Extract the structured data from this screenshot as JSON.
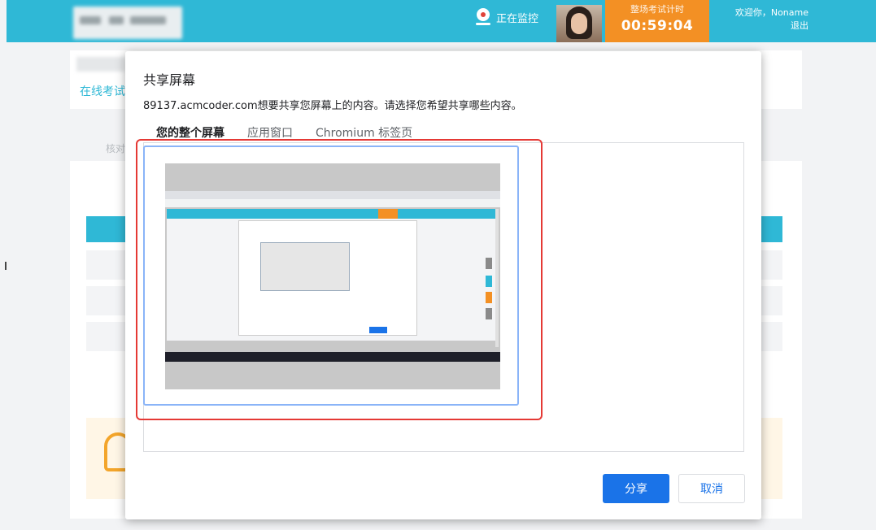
{
  "header": {
    "monitor_status": "正在监控",
    "timer_label": "整场考试计时",
    "timer_value": "00:59:04",
    "welcome_text": "欢迎你，Noname",
    "logout_label": "退出"
  },
  "background": {
    "tab_label": "在线考试",
    "section_label": "核对"
  },
  "dialog": {
    "title": "共享屏幕",
    "description": "89137.acmcoder.com想要共享您屏幕上的内容。请选择您希望共享哪些内容。",
    "tabs": [
      {
        "label": "您的整个屏幕",
        "active": true
      },
      {
        "label": "应用窗口",
        "active": false
      },
      {
        "label": "Chromium 标签页",
        "active": false
      }
    ],
    "share_button": "分享",
    "cancel_button": "取消"
  },
  "colors": {
    "header_bg": "#2fb8d6",
    "timer_bg": "#f39024",
    "primary_button": "#1a73e8",
    "highlight_border": "#e53935"
  }
}
